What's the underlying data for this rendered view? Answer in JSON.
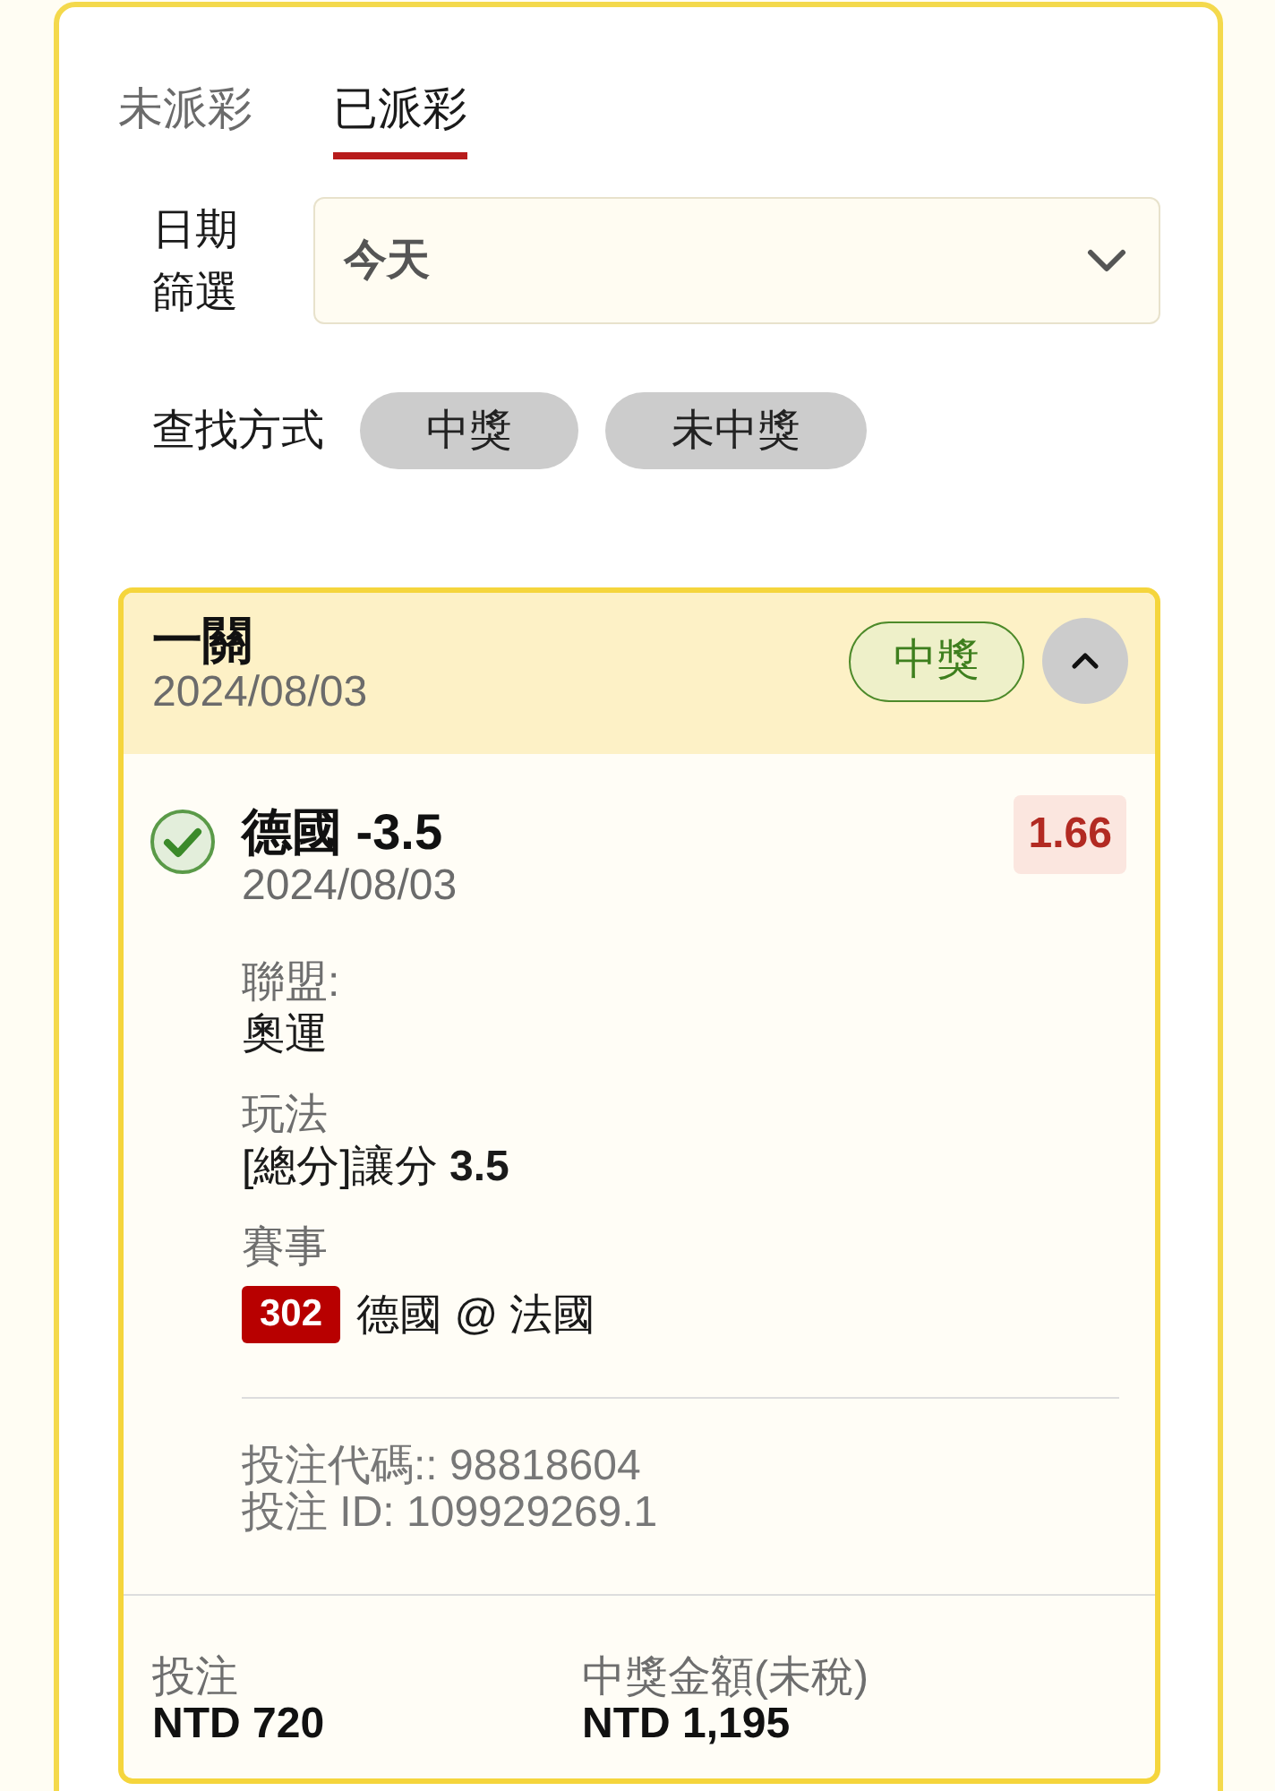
{
  "tabs": [
    {
      "label": "未派彩",
      "selected": false
    },
    {
      "label": "已派彩",
      "selected": true
    }
  ],
  "date_filter": {
    "label": "日期篩選",
    "value": "今天"
  },
  "search_method": {
    "label": "查找方式",
    "options": [
      {
        "label": "中獎",
        "selected": false
      },
      {
        "label": "未中獎",
        "selected": false
      }
    ]
  },
  "bet": {
    "type": "一關",
    "date": "2024/08/03",
    "status": {
      "label": "中獎",
      "kind": "won"
    },
    "expanded": true,
    "selection": {
      "won": true,
      "title": "德國 -3.5",
      "date": "2024/08/03",
      "odds": "1.66",
      "details": [
        {
          "kind": "text",
          "label": "聯盟:",
          "value": "奧運"
        },
        {
          "kind": "text",
          "label": "玩法",
          "value": "[總分]讓分 **3.5**"
        },
        {
          "kind": "match",
          "label": "賽事",
          "match_no": "302",
          "value": "德國 @ 法國"
        }
      ]
    },
    "references": [
      "投注代碼:: 98818604",
      "投注 ID: 109929269.1"
    ],
    "totals": [
      {
        "label": "投注",
        "value": "NTD 720"
      },
      {
        "label": "中獎金額(未稅)",
        "value": "NTD 1,195"
      }
    ]
  }
}
